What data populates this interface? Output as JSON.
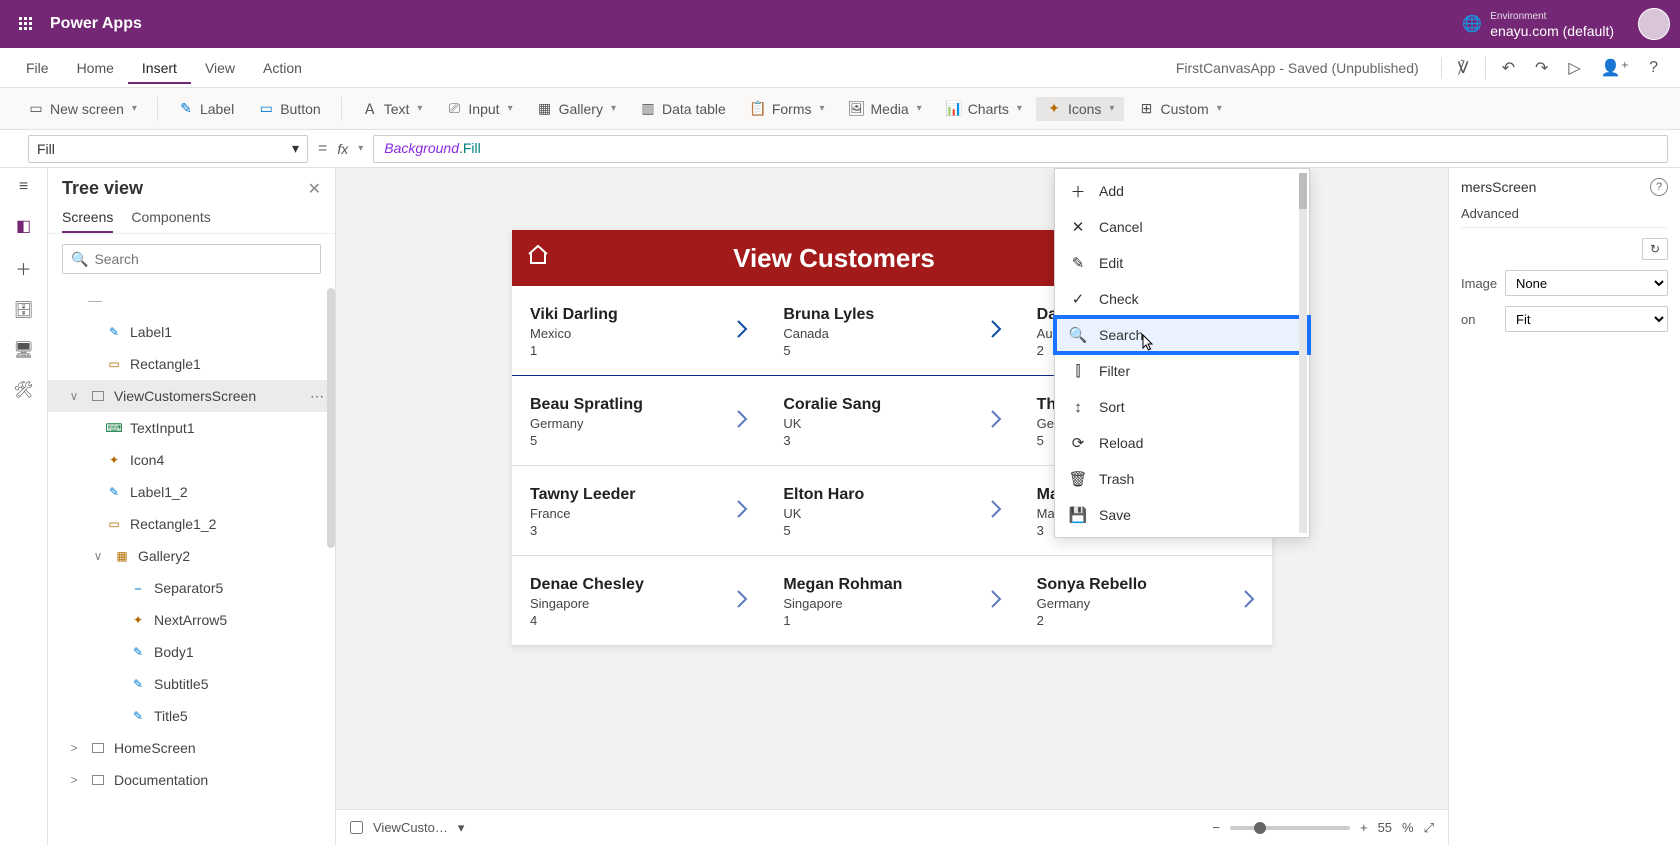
{
  "topbar": {
    "brand": "Power Apps",
    "env_label": "Environment",
    "env_value": "enayu.com (default)"
  },
  "menubar": {
    "items": [
      "File",
      "Home",
      "Insert",
      "View",
      "Action"
    ],
    "active_index": 2,
    "docstate": "FirstCanvasApp - Saved (Unpublished)"
  },
  "ribbon": {
    "new_screen": "New screen",
    "label": "Label",
    "button": "Button",
    "text": "Text",
    "input": "Input",
    "gallery": "Gallery",
    "data_table": "Data table",
    "forms": "Forms",
    "media": "Media",
    "charts": "Charts",
    "icons": "Icons",
    "custom": "Custom"
  },
  "fxbar": {
    "property": "Fill",
    "formula_tok1": "Background",
    "formula_tok2": ".Fill"
  },
  "treepanel": {
    "title": "Tree view",
    "tabs": [
      "Screens",
      "Components"
    ],
    "active_tab": 0,
    "search_placeholder": "Search",
    "nodes": [
      {
        "level": 1,
        "label": "Label1",
        "icon": "label"
      },
      {
        "level": 1,
        "label": "Rectangle1",
        "icon": "rect"
      },
      {
        "level": 0,
        "label": "ViewCustomersScreen",
        "icon": "screen",
        "selected": true,
        "expandable": true,
        "expanded": true,
        "dots": true
      },
      {
        "level": 1,
        "label": "TextInput1",
        "icon": "input"
      },
      {
        "level": 1,
        "label": "Icon4",
        "icon": "iconset"
      },
      {
        "level": 1,
        "label": "Label1_2",
        "icon": "label"
      },
      {
        "level": 1,
        "label": "Rectangle1_2",
        "icon": "rect"
      },
      {
        "level": 1,
        "label": "Gallery2",
        "icon": "gallery",
        "expandable": true,
        "expanded": true
      },
      {
        "level": 2,
        "label": "Separator5",
        "icon": "sep"
      },
      {
        "level": 2,
        "label": "NextArrow5",
        "icon": "iconset"
      },
      {
        "level": 2,
        "label": "Body1",
        "icon": "label"
      },
      {
        "level": 2,
        "label": "Subtitle5",
        "icon": "label"
      },
      {
        "level": 2,
        "label": "Title5",
        "icon": "label"
      },
      {
        "level": 0,
        "label": "HomeScreen",
        "icon": "screen",
        "expandable": true,
        "expanded": false
      },
      {
        "level": 0,
        "label": "Documentation",
        "icon": "screen",
        "expandable": true,
        "expanded": false
      }
    ]
  },
  "apppreview": {
    "header_title": "View Customers",
    "cards": [
      {
        "name": "Viki  Darling",
        "country": "Mexico",
        "idx": "1"
      },
      {
        "name": "Bruna  Lyles",
        "country": "Canada",
        "idx": "5"
      },
      {
        "name": "Daine  Zamora",
        "country": "Australia",
        "idx": "2"
      },
      {
        "name": "Beau  Spratling",
        "country": "Germany",
        "idx": "5"
      },
      {
        "name": "Coralie  Sang",
        "country": "UK",
        "idx": "3"
      },
      {
        "name": "Thresa  Milstead",
        "country": "Germany",
        "idx": "5"
      },
      {
        "name": "Tawny  Leeder",
        "country": "France",
        "idx": "3"
      },
      {
        "name": "Elton  Haro",
        "country": "UK",
        "idx": "5"
      },
      {
        "name": "Madaline  Neblett",
        "country": "Malayasia",
        "idx": "3"
      },
      {
        "name": "Denae  Chesley",
        "country": "Singapore",
        "idx": "4"
      },
      {
        "name": "Megan  Rohman",
        "country": "Singapore",
        "idx": "1"
      },
      {
        "name": "Sonya  Rebello",
        "country": "Germany",
        "idx": "2"
      }
    ]
  },
  "statusbar": {
    "breadcrumb": "ViewCusto…",
    "zoom_pct": "55",
    "zoom_pct_suffix": "%"
  },
  "iconmenu": {
    "items": [
      {
        "label": "Add",
        "glyph": "＋"
      },
      {
        "label": "Cancel",
        "glyph": "✕"
      },
      {
        "label": "Edit",
        "glyph": "✎"
      },
      {
        "label": "Check",
        "glyph": "✓"
      },
      {
        "label": "Search",
        "glyph": "🔍",
        "highlight": true
      },
      {
        "label": "Filter",
        "glyph": "⫿"
      },
      {
        "label": "Sort",
        "glyph": "↕"
      },
      {
        "label": "Reload",
        "glyph": "⟳"
      },
      {
        "label": "Trash",
        "glyph": "🗑"
      },
      {
        "label": "Save",
        "glyph": "💾"
      }
    ]
  },
  "proppanel": {
    "title_suffix": "mersScreen",
    "tab_advanced": "Advanced",
    "prop_image_label": "Image",
    "prop_image_value": "None",
    "prop_pos_label": "on",
    "prop_pos_value": "Fit"
  }
}
